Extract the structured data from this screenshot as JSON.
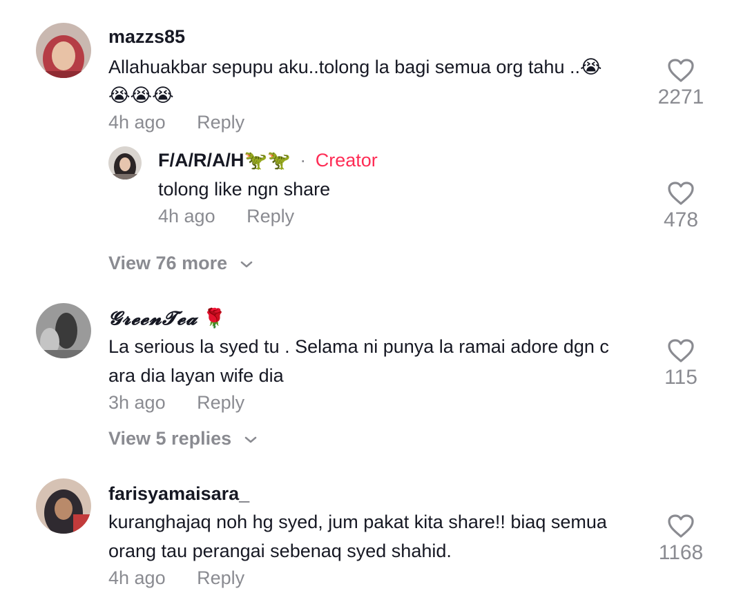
{
  "comments": [
    {
      "username": "mazzs85",
      "text_line1": "Allahuakbar sepupu aku..tolong la bagi semua org tahu ..😭",
      "text_line2": "😭😭😭",
      "time": "4h ago",
      "reply_label": "Reply",
      "likes": "2271",
      "avatar_icon": "avatar-photo",
      "reply": {
        "username": "F/A/R/A/H🦖🦖",
        "separator": "·",
        "badge": "Creator",
        "text": "tolong like ngn share",
        "time": "4h ago",
        "reply_label": "Reply",
        "likes": "478"
      },
      "view_more": "View 76 more"
    },
    {
      "username": "𝓖𝓻𝓮𝓮𝓷𝓣𝓮𝓪",
      "username_emoji": "🌹",
      "text_line1": "La serious la syed tu . Selama ni punya la ramai adore dgn c",
      "text_line2": "ara dia layan wife dia",
      "time": "3h ago",
      "reply_label": "Reply",
      "likes": "115",
      "view_more": "View 5 replies"
    },
    {
      "username": "farisyamaisara_",
      "text_line1": "kuranghajaq noh hg syed, jum pakat kita share!! biaq semua",
      "text_line2": "orang tau perangai sebenaq syed shahid.",
      "time": "4h ago",
      "reply_label": "Reply",
      "likes": "1168"
    }
  ],
  "colors": {
    "text": "#161823",
    "muted": "#8a8b91",
    "creator": "#fe2c55"
  },
  "icons": [
    "heart-icon",
    "chevron-down-icon"
  ]
}
